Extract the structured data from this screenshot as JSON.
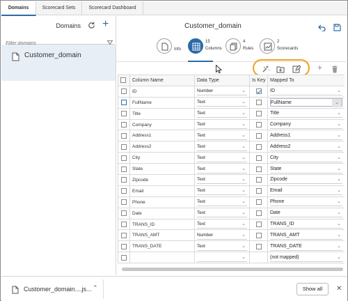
{
  "tabs": [
    {
      "label": "Domains",
      "active": true
    },
    {
      "label": "Scorecard Sets",
      "active": false
    },
    {
      "label": "Scorecard Dashboard",
      "active": false
    }
  ],
  "left_panel": {
    "title": "Domains",
    "filter_placeholder": "Filter domains",
    "items": [
      "Customer_domain"
    ]
  },
  "main": {
    "title": "Customer_domain",
    "views": [
      {
        "num": "",
        "label": "Info"
      },
      {
        "num": "15",
        "label": "Columns"
      },
      {
        "num": "4",
        "label": "Rules"
      },
      {
        "num": "2",
        "label": "Scorecards"
      }
    ]
  },
  "table": {
    "headers": [
      "",
      "Column Name",
      "Data Type",
      "Is Key",
      "Mapped To"
    ],
    "rows": [
      {
        "name": "ID",
        "type": "Number",
        "key": true,
        "mapped": "ID"
      },
      {
        "name": "FullName",
        "type": "Text",
        "key": false,
        "mapped": "FullName"
      },
      {
        "name": "Title",
        "type": "Text",
        "key": false,
        "mapped": "Title"
      },
      {
        "name": "Company",
        "type": "Text",
        "key": false,
        "mapped": "Company"
      },
      {
        "name": "Address1",
        "type": "Text",
        "key": false,
        "mapped": "Address1"
      },
      {
        "name": "Address2",
        "type": "Text",
        "key": false,
        "mapped": "Address2"
      },
      {
        "name": "City",
        "type": "Text",
        "key": false,
        "mapped": "City"
      },
      {
        "name": "State",
        "type": "Text",
        "key": false,
        "mapped": "State"
      },
      {
        "name": "Zipcode",
        "type": "Text",
        "key": false,
        "mapped": "Zipcode"
      },
      {
        "name": "Email",
        "type": "Text",
        "key": false,
        "mapped": "Email"
      },
      {
        "name": "Phone",
        "type": "Text",
        "key": false,
        "mapped": "Phone"
      },
      {
        "name": "Date",
        "type": "Text",
        "key": false,
        "mapped": "Date"
      },
      {
        "name": "TRANS_ID",
        "type": "Text",
        "key": false,
        "mapped": "TRANS_ID"
      },
      {
        "name": "TRANS_AMT",
        "type": "Number",
        "key": false,
        "mapped": "TRANS_AMT"
      },
      {
        "name": "TRANS_DATE",
        "type": "Text",
        "key": false,
        "mapped": "TRANS_DATE"
      },
      {
        "name": "",
        "type": "",
        "key": false,
        "mapped": "(not mapped)"
      }
    ]
  },
  "download_bar": {
    "file": "Customer_domain....js...",
    "show_all": "Show all"
  },
  "colors": {
    "accent": "#2b6aa6",
    "highlight": "#f0a21e"
  }
}
